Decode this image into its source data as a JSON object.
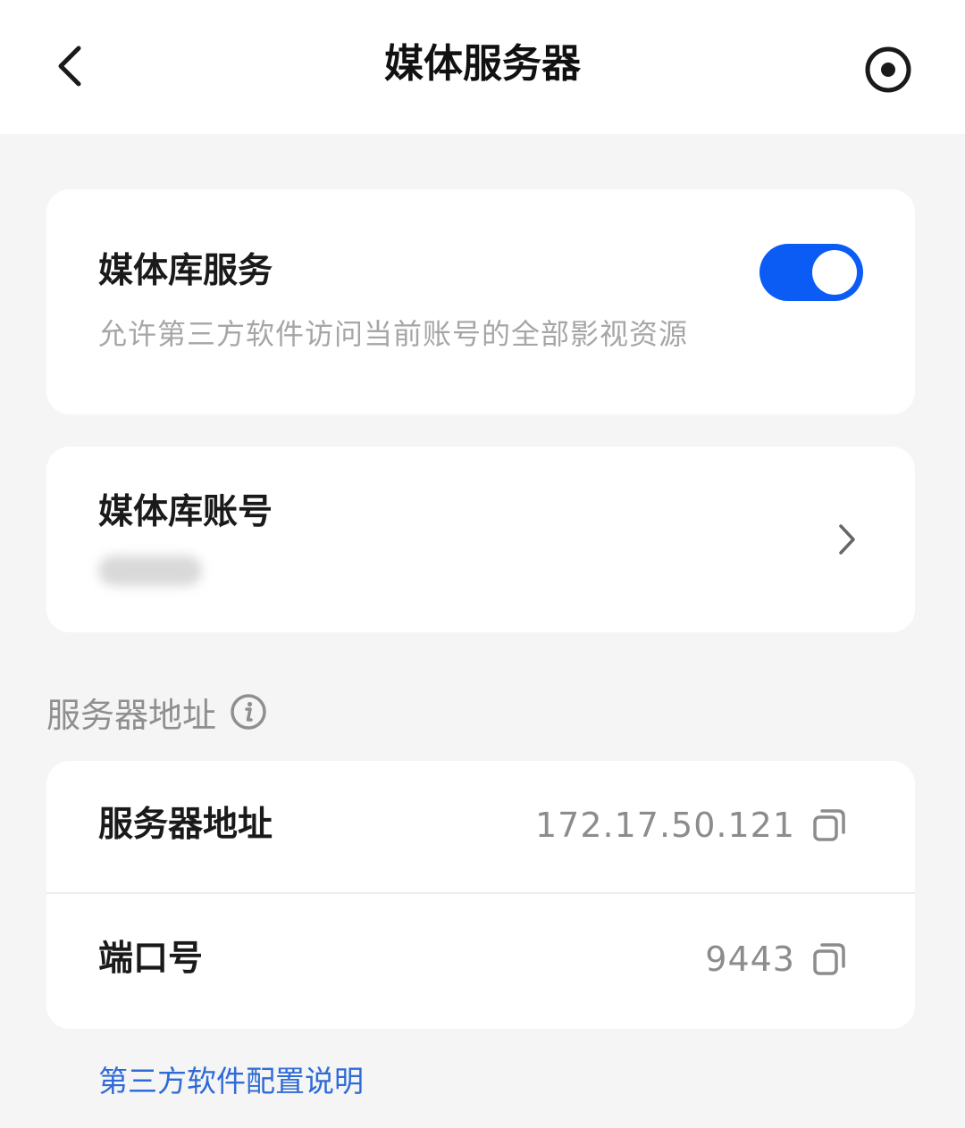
{
  "header": {
    "title": "媒体服务器",
    "back_icon": "chevron-left-icon",
    "right_icon": "target-icon"
  },
  "media_service": {
    "title": "媒体库服务",
    "description": "允许第三方软件访问当前账号的全部影视资源",
    "toggle_on": true,
    "accent_color": "#0a5cf5"
  },
  "media_account": {
    "title": "媒体库账号",
    "value_masked": true
  },
  "server_section": {
    "label": "服务器地址",
    "info_icon": "info-icon"
  },
  "server_address": {
    "label": "服务器地址",
    "value": "172.17.50.121"
  },
  "port": {
    "label": "端口号",
    "value": "9443"
  },
  "config_link": {
    "label": "第三方软件配置说明",
    "color": "#2f6bd6"
  }
}
